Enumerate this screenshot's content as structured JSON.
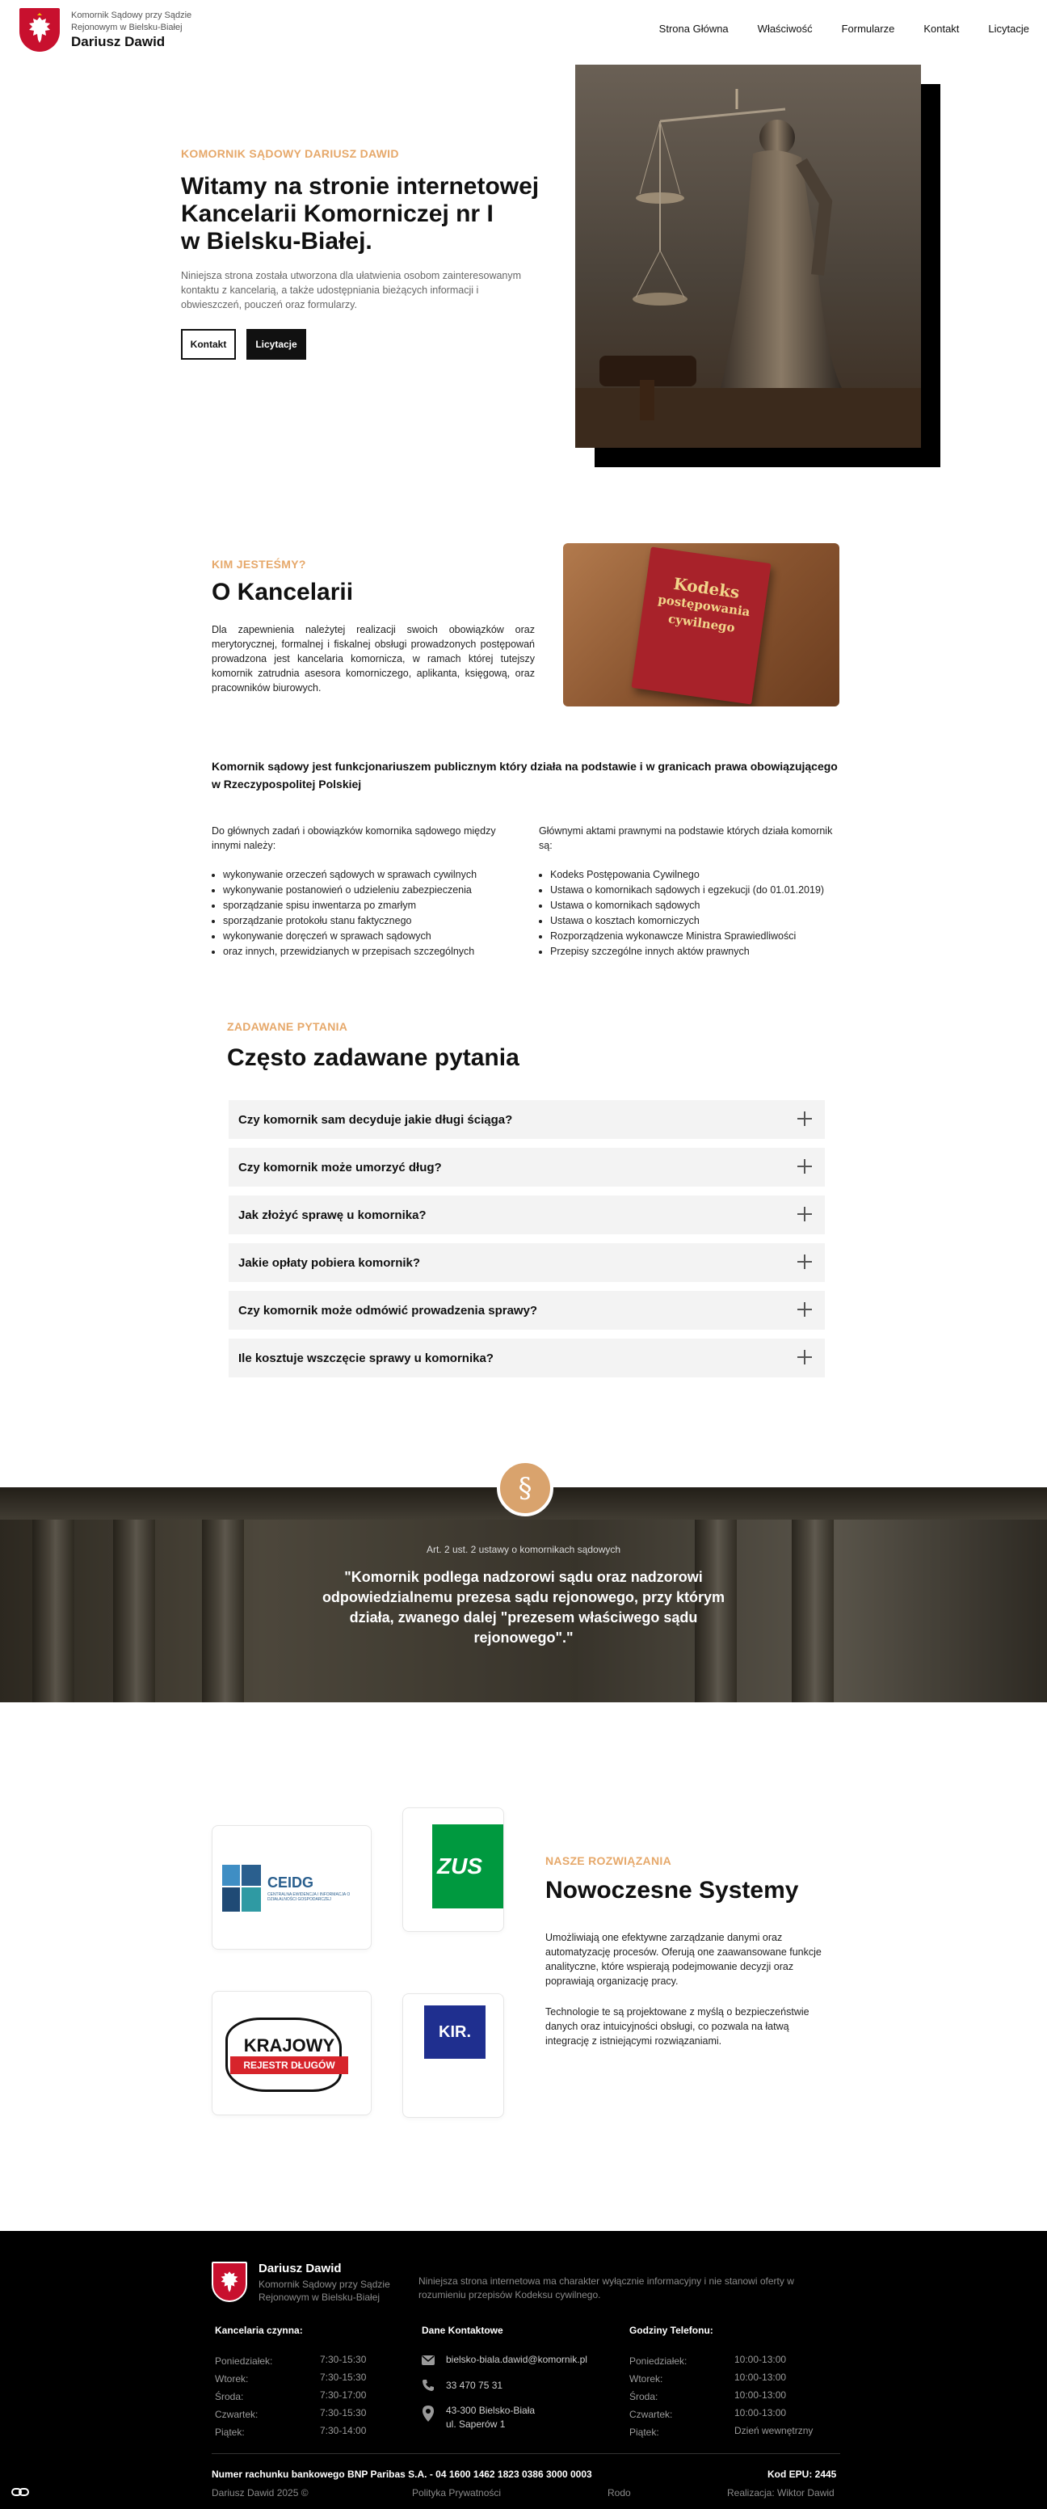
{
  "header": {
    "brand_sub": "Komornik Sądowy  przy Sądzie Rejonowym w Bielsku-Białej",
    "brand_name": "Dariusz Dawid",
    "nav": [
      "Strona Główna",
      "Właściwość",
      "Formularze",
      "Kontakt",
      "Licytacje"
    ]
  },
  "hero": {
    "eyebrow": "KOMORNIK SĄDOWY DARIUSZ DAWID",
    "title_lines": [
      "Witamy na stronie internetowej",
      "Kancelarii Komorniczej nr I",
      "w Bielsku-Białej."
    ],
    "desc": "Niniejsza strona została utworzona dla ułatwienia osobom zainteresowanym kontaktu z kancelarią, a także udostępniania bieżących informacji i obwieszczeń, pouczeń oraz formularzy.",
    "btn_contact": "Kontakt",
    "btn_auctions": "Licytacje"
  },
  "about": {
    "eyebrow": "KIM JESTEŚMY?",
    "title": "O Kancelarii",
    "text": "Dla zapewnienia należytej realizacji swoich obowiązków oraz merytorycznej, formalnej i fiskalnej obsługi prowadzonych postępowań prowadzona jest kancelaria komornicza, w ramach której tutejszy komornik zatrudnia asesora komorniczego, aplikanta, księgową, oraz pracowników biurowych.",
    "book_line1": "Kodeks",
    "book_line2": "postępowania",
    "book_line3": "cywilnego"
  },
  "duties": {
    "bold": "Komornik sądowy jest funkcjonariuszem publicznym który działa na podstawie i w granicach prawa obowiązującego w Rzeczypospolitej Polskiej",
    "left_intro": "Do głównych zadań i obowiązków komornika sądowego między innymi należy:",
    "left_items": [
      "wykonywanie orzeczeń sądowych w sprawach cywilnych",
      "wykonywanie postanowień o udzieleniu zabezpieczenia",
      "sporządzanie spisu inwentarza po zmarłym",
      "sporządzanie protokołu stanu faktycznego",
      "wykonywanie doręczeń w sprawach sądowych",
      "oraz innych, przewidzianych w przepisach szczególnych"
    ],
    "right_intro": "Głównymi aktami prawnymi na podstawie których działa komornik są:",
    "right_items": [
      "Kodeks Postępowania Cywilnego",
      "Ustawa o komornikach sądowych i egzekucji (do 01.01.2019)",
      "Ustawa o komornikach sądowych",
      "Ustawa o kosztach komorniczych",
      "Rozporządzenia wykonawcze Ministra Sprawiedliwości",
      "Przepisy szczególne innych aktów prawnych"
    ]
  },
  "faq": {
    "eyebrow": "ZADAWANE PYTANIA",
    "title": "Często zadawane pytania",
    "items": [
      "Czy komornik sam decyduje jakie długi ściąga?",
      "Czy komornik może umorzyć dług?",
      "Jak złożyć sprawę u komornika?",
      "Jakie opłaty pobiera komornik?",
      "Czy komornik może odmówić prowadzenia sprawy?",
      "Ile kosztuje wszczęcie sprawy u komornika?"
    ]
  },
  "quote": {
    "symbol": "§",
    "source": "Art. 2 ust. 2 ustawy o komornikach sądowych",
    "lines": [
      "\"Komornik podlega nadzorowi sądu oraz nadzorowi",
      "odpowiedzialnemu prezesa sądu rejonowego, przy którym",
      "działa, zwanego dalej \"prezesem właściwego sądu",
      "rejonowego\".\""
    ]
  },
  "systems": {
    "eyebrow": "NASZE ROZWIĄZANIA",
    "title": "Nowoczesne Systemy",
    "p1": "Umożliwiają one efektywne zarządzanie danymi oraz automatyzację procesów. Oferują one zaawansowane funkcje analityczne, które wspierają podejmowanie decyzji oraz poprawiają organizację pracy.",
    "p2": "Technologie te są projektowane z myślą o bezpieczeństwie danych oraz intuicyjności obsługi, co pozwala na łatwą integrację z istniejącymi rozwiązaniami.",
    "logos": {
      "ceidg": "CEIDG",
      "ceidg_sub": "CENTRALNA EWIDENCJA I INFORMACJA O DZIAŁALNOŚCI GOSPODARCZEJ",
      "zus": "ZUS",
      "krajowy": "KRAJOWY",
      "krajowy_sub": "REJESTR DŁUGÓW",
      "kir": "KIR."
    }
  },
  "footer": {
    "name": "Dariusz Dawid",
    "sub": "Komornik Sądowy przy Sądzie Rejonowym w Bielsku-Białej",
    "desc": "Niniejsza strona internetowa ma charakter wyłącznie informacyjny i nie stanowi oferty w rozumieniu przepisów Kodeksu cywilnego.",
    "office_head": "Kancelaria czynna:",
    "contact_head": "Dane Kontaktowe",
    "phone_head": "Godziny Telefonu:",
    "office_hours": [
      {
        "day": "Poniedziałek:",
        "hours": "7:30-15:30"
      },
      {
        "day": "Wtorek:",
        "hours": "7:30-15:30"
      },
      {
        "day": "Środa:",
        "hours": "7:30-17:00"
      },
      {
        "day": "Czwartek:",
        "hours": "7:30-15:30"
      },
      {
        "day": "Piątek:",
        "hours": "7:30-14:00"
      }
    ],
    "email": "bielsko-biala.dawid@komornik.pl",
    "phone": "33 470 75 31",
    "address1": "43-300 Bielsko-Biała",
    "address2": "ul. Saperów 1",
    "phone_hours": [
      {
        "day": "Poniedziałek:",
        "hours": "10:00-13:00"
      },
      {
        "day": "Wtorek:",
        "hours": "10:00-13:00"
      },
      {
        "day": "Środa:",
        "hours": "10:00-13:00"
      },
      {
        "day": "Czwartek:",
        "hours": "10:00-13:00"
      },
      {
        "day": "Piątek:",
        "hours": "Dzień wewnętrzny"
      }
    ],
    "bank": "Numer rachunku bankowego BNP Paribas S.A. - 04 1600 1462 1823 0386 3000 0003",
    "epu": "Kod EPU: 2445",
    "copyright": "Dariusz Dawid 2025 ©",
    "privacy": "Polityka Prywatności",
    "rodo": "Rodo",
    "credit": "Realizacja: Wiktor Dawid"
  },
  "colors": {
    "accent": "#e6a86a",
    "dark": "#111111",
    "emblem_red": "#c8102e",
    "faq_bg": "#f3f3f3"
  }
}
